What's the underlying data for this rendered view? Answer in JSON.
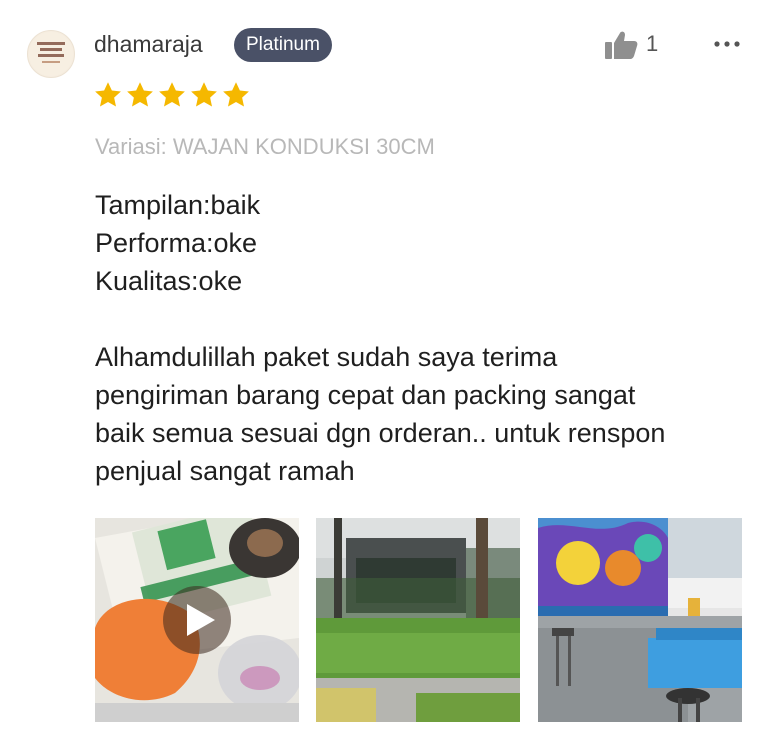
{
  "user": {
    "name": "dhamaraja",
    "badge": "Platinum",
    "avatar_icon": "shop-logo-avatar"
  },
  "rating": {
    "stars": 5,
    "max": 5,
    "color": "#f5b800"
  },
  "actions": {
    "like_count": "1",
    "like_icon": "thumbs-up-icon",
    "more_icon": "more-dots-icon"
  },
  "variation": "Variasi: WAJAN KONDUKSI 30CM",
  "review": {
    "lines": [
      "Tampilan:baik",
      "Performa:oke",
      "Kualitas:oke"
    ],
    "paragraph": [
      "Alhamdulillah paket sudah saya terima",
      "pengiriman barang cepat dan packing sangat",
      "baik semua sesuai dgn orderan.. untuk renspon",
      "penjual sangat ramah"
    ]
  },
  "media": [
    {
      "type": "video",
      "description_icon": "play-icon"
    },
    {
      "type": "image"
    },
    {
      "type": "image"
    }
  ],
  "colors": {
    "badge_bg": "#4a5167",
    "text": "#1f1f1f",
    "muted": "#b8b8b8"
  }
}
